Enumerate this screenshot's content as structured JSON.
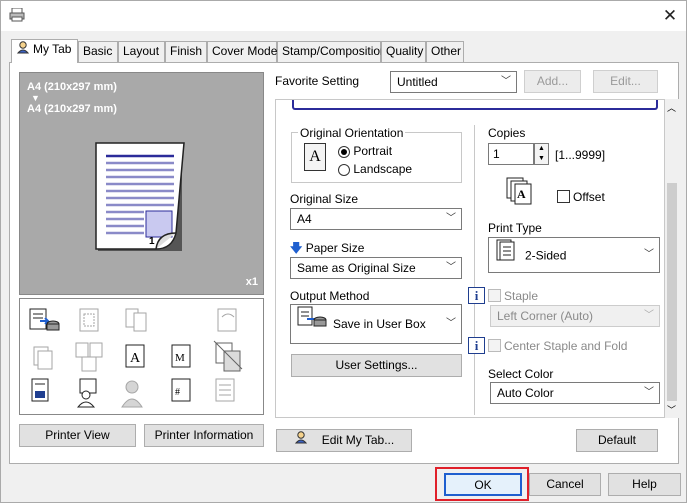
{
  "window": {
    "close": "✕"
  },
  "tabs": [
    "My Tab",
    "Basic",
    "Layout",
    "Finish",
    "Cover Mode",
    "Stamp/Composition",
    "Quality",
    "Other"
  ],
  "preview": {
    "line1": "A4 (210x297 mm)",
    "arrow": "▼",
    "line2": "A4 (210x297 mm)",
    "count": "x1",
    "page_num": "1"
  },
  "left_buttons": {
    "printer_view": "Printer View",
    "printer_info": "Printer Information"
  },
  "favorite": {
    "label": "Favorite Setting",
    "value": "Untitled",
    "add": "Add...",
    "edit": "Edit..."
  },
  "orientation": {
    "legend": "Original Orientation",
    "portrait": "Portrait",
    "landscape": "Landscape",
    "selected": "Portrait"
  },
  "original_size": {
    "label": "Original Size",
    "value": "A4"
  },
  "paper_size": {
    "label": "Paper Size",
    "value": "Same as Original Size"
  },
  "output_method": {
    "label": "Output Method",
    "value": "Save in User Box"
  },
  "user_settings": "User Settings...",
  "copies": {
    "label": "Copies",
    "value": "1",
    "range": "[1...9999]"
  },
  "offset": {
    "label": "Offset",
    "checked": false
  },
  "print_type": {
    "label": "Print Type",
    "value": "2-Sided"
  },
  "staple": {
    "label": "Staple",
    "value": "Left Corner (Auto)"
  },
  "center_staple": {
    "label": "Center Staple and Fold"
  },
  "select_color": {
    "label": "Select Color",
    "value": "Auto Color"
  },
  "bottom": {
    "edit_my_tab": "Edit My Tab...",
    "default": "Default"
  },
  "dialog": {
    "ok": "OK",
    "cancel": "Cancel",
    "help": "Help"
  },
  "info_glyph": "i",
  "colors": {
    "ok_highlight": "#e0202a",
    "accent_blue": "#1f5fcf",
    "preview_bg": "#a9a9a9",
    "preview_text": "#ffffff"
  }
}
